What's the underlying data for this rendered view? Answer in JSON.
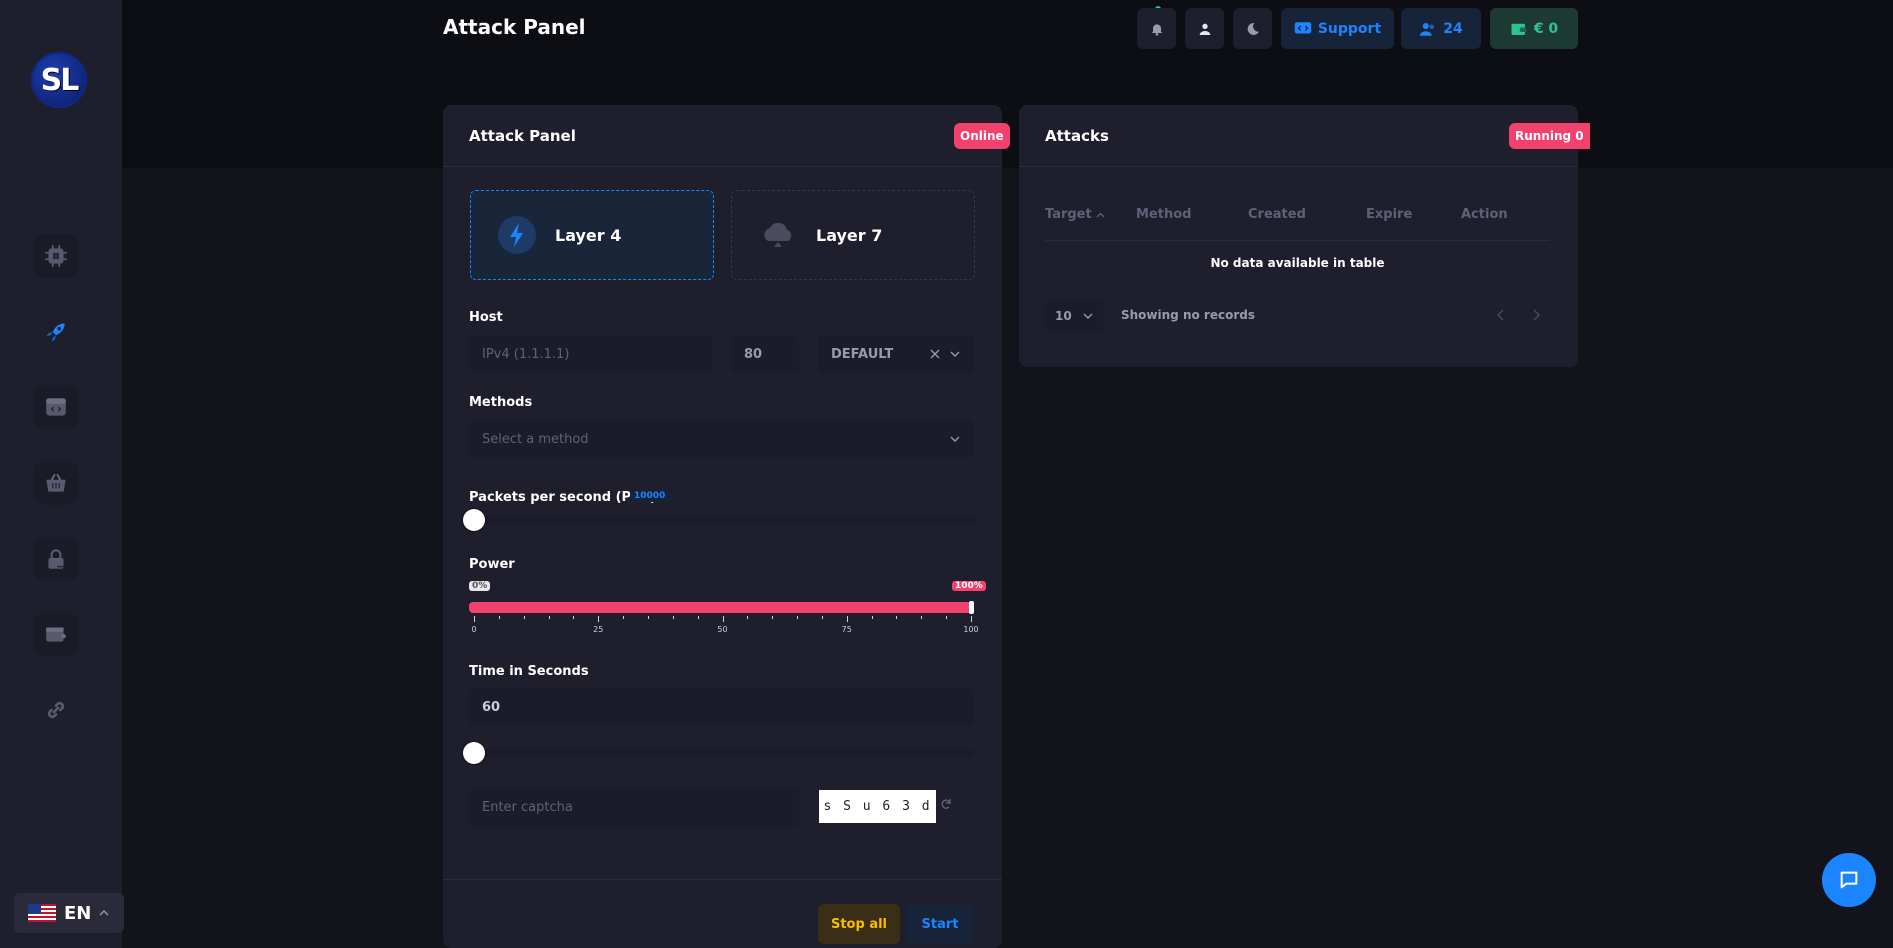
{
  "header": {
    "title": "Attack Panel",
    "support_label": "Support",
    "users_count": "24",
    "balance": "€ 0"
  },
  "sidebar": {
    "logo_text": "SL",
    "items": [
      {
        "icon": "cpu-icon"
      },
      {
        "icon": "rocket-icon"
      },
      {
        "icon": "code-window-icon"
      },
      {
        "icon": "basket-icon"
      },
      {
        "icon": "lock-icon"
      },
      {
        "icon": "wallet-icon"
      },
      {
        "icon": "link-icon"
      }
    ],
    "language": "EN"
  },
  "attack_panel": {
    "title": "Attack Panel",
    "status": "Online",
    "layers": [
      {
        "label": "Layer 4",
        "icon": "lightning-icon",
        "active": true
      },
      {
        "label": "Layer 7",
        "icon": "cloud-icon",
        "active": false
      }
    ],
    "host_label": "Host",
    "host_placeholder": "IPv4 (1.1.1.1)",
    "port_value": "80",
    "default_select": "DEFAULT",
    "methods_label": "Methods",
    "method_placeholder": "Select a method",
    "pps_label": "Packets per second (PPS):",
    "pps_value": "10000",
    "pps_slider_fraction": 0.0,
    "power_label": "Power",
    "power_min_tag": "0%",
    "power_max_tag": "100%",
    "power_value_percent": 100,
    "power_ticks": [
      "0",
      "25",
      "50",
      "75",
      "100"
    ],
    "time_label": "Time in Seconds",
    "time_value": "60",
    "time_slider_fraction": 0.0,
    "captcha_placeholder": "Enter captcha",
    "captcha_text": "s S u 6 3 d",
    "stop_all_label": "Stop all",
    "start_label": "Start"
  },
  "attacks": {
    "title": "Attacks",
    "running_label": "Running 0",
    "columns": [
      "Target",
      "Method",
      "Created",
      "Expire",
      "Action"
    ],
    "empty_text": "No data available in table",
    "page_size": "10",
    "records_text": "Showing no records"
  },
  "colors": {
    "accent_blue": "#1b84ff",
    "danger": "#f1416c",
    "warning": "#f6c000",
    "success": "#2fc48e"
  }
}
